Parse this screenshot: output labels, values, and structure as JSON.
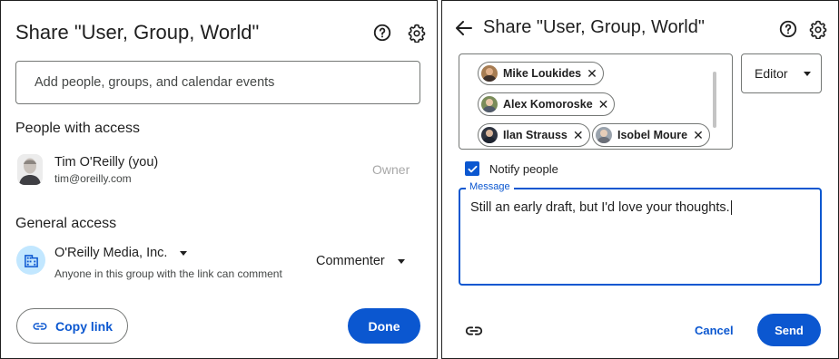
{
  "left": {
    "title": "Share \"User, Group, World\"",
    "help_icon": "help-circle-icon",
    "settings_icon": "gear-icon",
    "search_placeholder": "Add people, groups, and calendar events",
    "people_heading": "People with access",
    "person": {
      "name": "Tim O'Reilly (you)",
      "email": "tim@oreilly.com",
      "role": "Owner"
    },
    "general_heading": "General access",
    "org": {
      "name": "O'Reilly Media, Inc.",
      "description": "Anyone in this group with the link can comment",
      "role": "Commenter"
    },
    "copy_link_label": "Copy link",
    "done_label": "Done"
  },
  "right": {
    "title": "Share \"User, Group, World\"",
    "chips": [
      {
        "name": "Mike Loukides"
      },
      {
        "name": "Alex Komoroske"
      },
      {
        "name": "Ilan Strauss"
      },
      {
        "name": "Isobel Moure"
      }
    ],
    "role": "Editor",
    "notify_label": "Notify people",
    "notify_checked": true,
    "message_label": "Message",
    "message_text": "Still an early draft, but I'd love your thoughts.",
    "cancel_label": "Cancel",
    "send_label": "Send"
  },
  "colors": {
    "accent": "#0b57d0",
    "org_icon_bg": "#c2e7ff",
    "border": "#747775"
  }
}
